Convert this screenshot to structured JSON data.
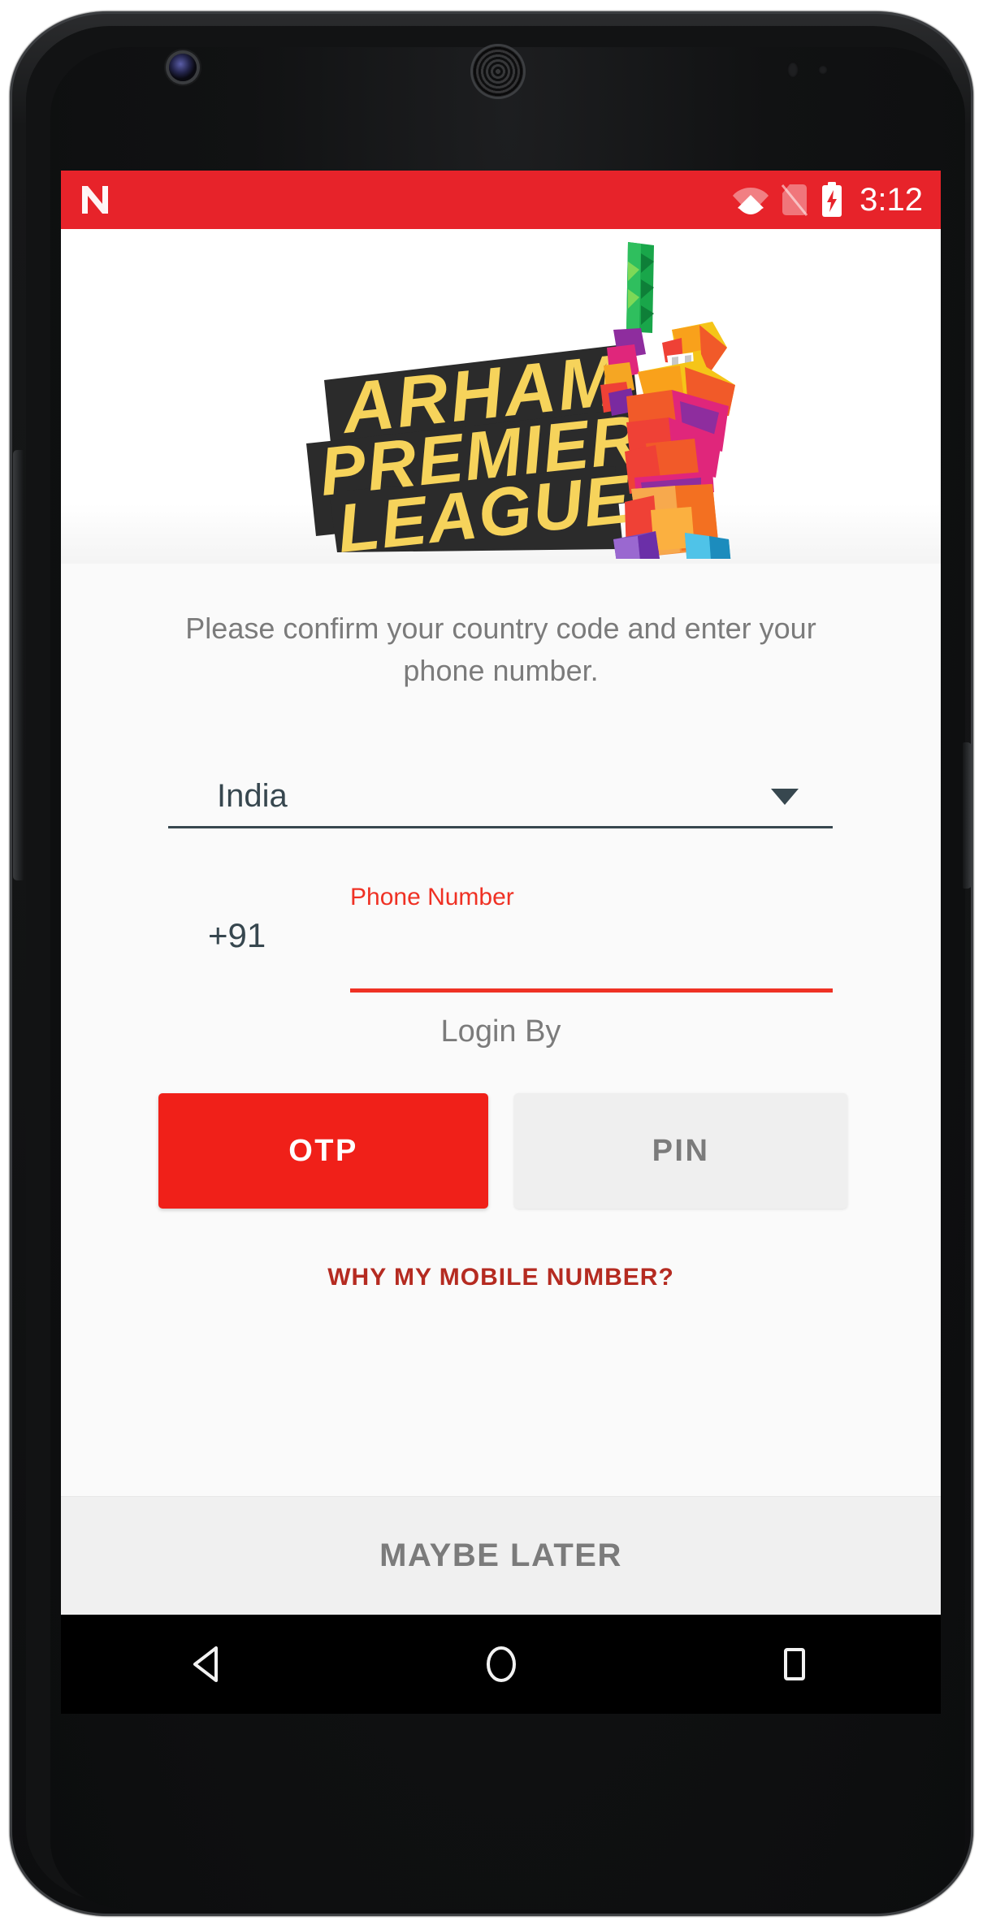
{
  "device": {
    "hardware": {
      "front_camera": "camera-icon",
      "earpiece": "speaker-grille",
      "proximity_sensor": "sensor",
      "volume_button": "volume-rocker",
      "power_button": "power-button"
    }
  },
  "status_bar": {
    "background_color": "#e7232a",
    "os_logo": "android-n-logo",
    "icons": [
      "wifi-icon",
      "no-sim-icon",
      "battery-charging-icon"
    ],
    "clock": "3:12"
  },
  "app": {
    "logo": {
      "line1": "ARHAM",
      "line2": "PREMIER",
      "line3": "LEAGUE",
      "mascot": "cricket-batsman-illustration",
      "text_color": "#f6d35b",
      "banner_color": "#2b2b2b"
    },
    "intro_text": "Please confirm your country code and enter your phone number.",
    "country_select": {
      "label": "country-select",
      "value": "India",
      "caret": "chevron-down-icon"
    },
    "phone": {
      "country_code": "+91",
      "field_label": "Phone Number",
      "value": "",
      "placeholder": "",
      "accent_color": "#ef3124"
    },
    "login_by": {
      "heading": "Login By",
      "options": [
        {
          "label": "OTP",
          "selected": true,
          "bg": "#f02019",
          "fg": "#ffffff"
        },
        {
          "label": "PIN",
          "selected": false,
          "bg": "#efefef",
          "fg": "#7b7b7b"
        }
      ]
    },
    "why_link": "WHY MY MOBILE NUMBER?",
    "maybe_later": "MAYBE LATER"
  },
  "nav_bar": {
    "background_color": "#000000",
    "buttons": [
      {
        "name": "back",
        "icon": "back-triangle-icon"
      },
      {
        "name": "home",
        "icon": "home-circle-icon"
      },
      {
        "name": "recents",
        "icon": "recents-square-icon"
      }
    ]
  }
}
